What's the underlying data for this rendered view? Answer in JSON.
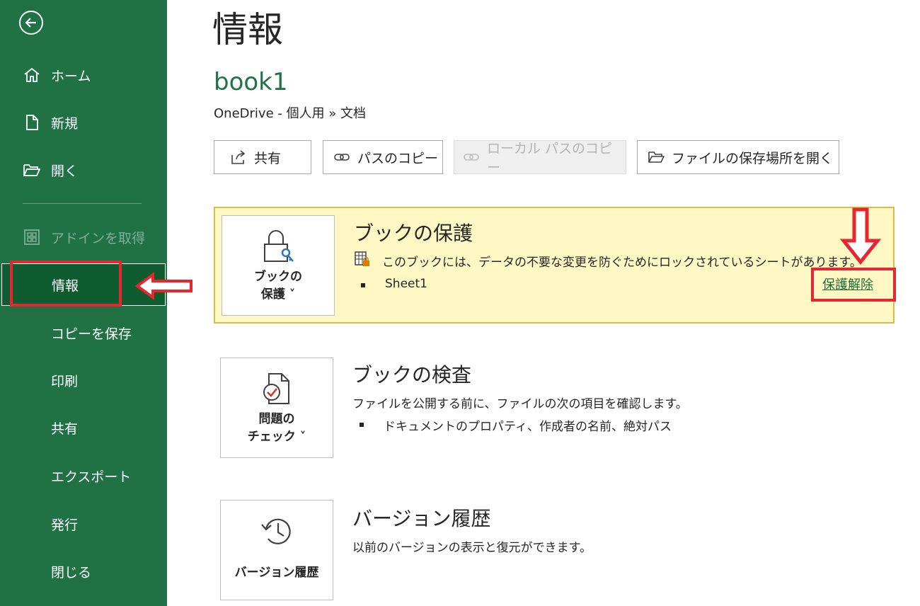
{
  "sidebar": {
    "items": [
      {
        "label": "ホーム",
        "icon": "home-icon"
      },
      {
        "label": "新規",
        "icon": "new-document-icon"
      },
      {
        "label": "開く",
        "icon": "open-folder-icon"
      },
      {
        "label": "アドインを取得",
        "icon": "addins-grid-icon",
        "disabled": true
      },
      {
        "label": "情報",
        "selected": true
      },
      {
        "label": "コピーを保存"
      },
      {
        "label": "印刷"
      },
      {
        "label": "共有"
      },
      {
        "label": "エクスポート"
      },
      {
        "label": "発行"
      },
      {
        "label": "閉じる"
      }
    ]
  },
  "main": {
    "title": "情報",
    "doc_name": "book1",
    "doc_path": "OneDrive - 個人用 » 文档",
    "buttons": {
      "share": "共有",
      "copy_path": "パスのコピー",
      "copy_local_path": "ローカル パスのコピー",
      "open_location": "ファイルの保存場所を開く"
    },
    "protect": {
      "tile_line1": "ブックの",
      "tile_line2": "保護 ˅",
      "heading": "ブックの保護",
      "text": "このブックには、データの不要な変更を防ぐためにロックされているシートがあります。",
      "sheet": "Sheet1",
      "unprotect_link": "保護解除"
    },
    "inspect": {
      "tile_line1": "問題の",
      "tile_line2": "チェック ˅",
      "heading": "ブックの検査",
      "text": "ファイルを公開する前に、ファイルの次の項目を確認します。",
      "bullet": "ドキュメントのプロパティ、作成者の名前、絶対パス"
    },
    "version": {
      "tile_label": "バージョン履歴",
      "heading": "バージョン履歴",
      "text": "以前のバージョンの表示と復元ができます。"
    }
  },
  "colors": {
    "sidebar_bg": "#207245",
    "selected_bg": "#0e5c2f",
    "accent_green": "#217346",
    "annotation_red": "#e8262f",
    "protect_bg": "#fff8c4"
  }
}
